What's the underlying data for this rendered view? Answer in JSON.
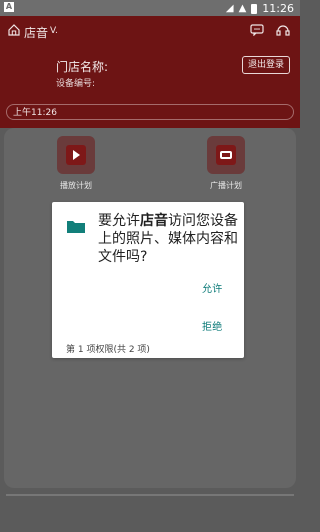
{
  "status_bar": {
    "left_badge": "A",
    "time": "11:26"
  },
  "header": {
    "store_title": "店音",
    "store_title_suffix": "V.",
    "store_name_label": "门店名称:",
    "device_label": "设备编号:",
    "logout_label": "退出登录",
    "time_chip": "上午11:26"
  },
  "tiles": [
    {
      "label": "播放计划"
    },
    {
      "label": "广播计划"
    }
  ],
  "dialog": {
    "title_prefix": "要允许",
    "title_app": "店音",
    "title_suffix": "访问您设备上的照片、媒体内容和文件吗?",
    "allow_label": "允许",
    "deny_label": "拒绝",
    "permission_count": "第 1 项权限(共 2 项)"
  },
  "colors": {
    "header_red": "#6d1414",
    "accent_teal": "#0b7a78",
    "dialog_bg": "#ffffff"
  },
  "icons": {
    "home": "home-icon",
    "chat": "message-icon",
    "headset": "headset-icon",
    "folder": "folder-icon",
    "play": "play-icon",
    "broadcast": "radio-icon",
    "wifi": "wifi-icon",
    "signal": "signal-icon",
    "battery": "battery-icon"
  }
}
